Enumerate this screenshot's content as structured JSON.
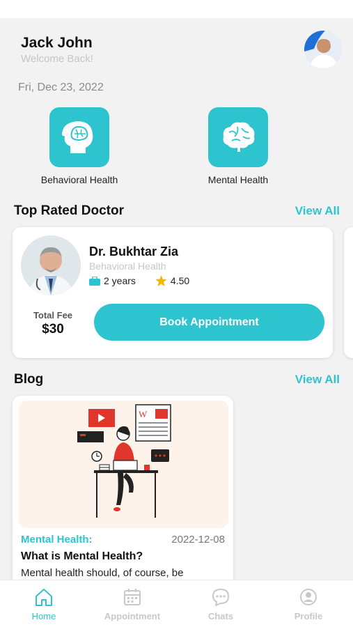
{
  "user": {
    "name": "Jack John",
    "subtitle": "Welcome Back!"
  },
  "date": "Fri, Dec 23, 2022",
  "categories": [
    {
      "label": "Behavioral Health",
      "icon": "head-brain-icon"
    },
    {
      "label": "Mental Health",
      "icon": "brain-icon"
    }
  ],
  "top_rated": {
    "title": "Top Rated Doctor",
    "view_all": "View All",
    "doctor": {
      "name": "Dr. Bukhtar Zia",
      "specialty": "Behavioral Health",
      "experience": "2 years",
      "rating": "4.50",
      "fee_label": "Total Fee",
      "fee_value": "$30",
      "book_label": "Book Appointment"
    }
  },
  "blog": {
    "title": "Blog",
    "view_all": "View All",
    "post": {
      "category": "Mental Health:",
      "date": "2022-12-08",
      "title": "What is Mental Health?",
      "excerpt": "Mental health should, of course, be"
    }
  },
  "tabs": [
    {
      "label": "Home",
      "icon": "home-icon",
      "active": true
    },
    {
      "label": "Appointment",
      "icon": "calendar-icon",
      "active": false
    },
    {
      "label": "Chats",
      "icon": "chat-icon",
      "active": false
    },
    {
      "label": "Profile",
      "icon": "profile-icon",
      "active": false
    }
  ],
  "colors": {
    "accent": "#2ec4cf",
    "background": "#f2f2f2",
    "star": "#f5b800"
  }
}
